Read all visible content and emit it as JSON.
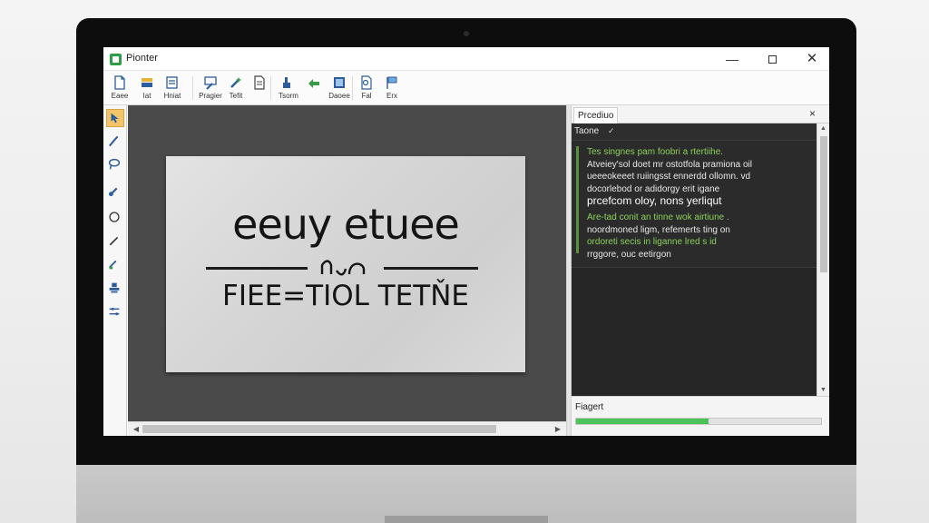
{
  "window": {
    "title": "Pionter",
    "minimize": "—",
    "close": "✕"
  },
  "toolbar": {
    "items": [
      {
        "label": "Eaee",
        "icon": "new-file-icon"
      },
      {
        "label": "Iat",
        "icon": "open-icon"
      },
      {
        "label": "Hniat",
        "icon": "print-icon"
      },
      {
        "label": "Pragier",
        "icon": "pen-icon"
      },
      {
        "label": "Tefit",
        "icon": "magic-icon"
      },
      {
        "label": "",
        "icon": "document-icon"
      },
      {
        "label": "Tsorm",
        "icon": "bucket-icon"
      },
      {
        "label": "",
        "icon": "export-icon"
      },
      {
        "label": "Daoee",
        "icon": "frame-icon"
      },
      {
        "label": "Fal",
        "icon": "search-doc-icon"
      },
      {
        "label": "Erx",
        "icon": "flag-icon"
      }
    ]
  },
  "canvas": {
    "line1": "eeuy etuee",
    "line2": "FIEE=TIOL TETŇE"
  },
  "panel": {
    "title": "Prcediuo",
    "close": "×",
    "console_tab": "Taone",
    "console_tab_close": "✓",
    "lines": [
      {
        "text": "Tes singnes pam foobri a rtertiihe.",
        "style": "green"
      },
      {
        "text": "Atveiey'sol doet mr ostotfola pramiona oil",
        "style": "normal"
      },
      {
        "text": "ueeeokeeet ruiingsst ennerdd ollomn. vd",
        "style": "normal"
      },
      {
        "text": "docorlebod or adidorgy erit igane",
        "style": "normal"
      },
      {
        "text": "prcefcom oloy, nons yerliqut",
        "style": "big"
      },
      {
        "text": "Are-tad conit an tinne wok airtiune .",
        "style": "green"
      },
      {
        "text": "noordmoned ligm, refemerts ting on",
        "style": "normal"
      },
      {
        "text": "ordoreti secis in liganne lred s id",
        "style": "green"
      },
      {
        "text": "rrggore, ouc eetirgon",
        "style": "normal"
      }
    ],
    "progress_label": "Fiagert",
    "progress": 0.54,
    "accent": "#4cc25a"
  }
}
